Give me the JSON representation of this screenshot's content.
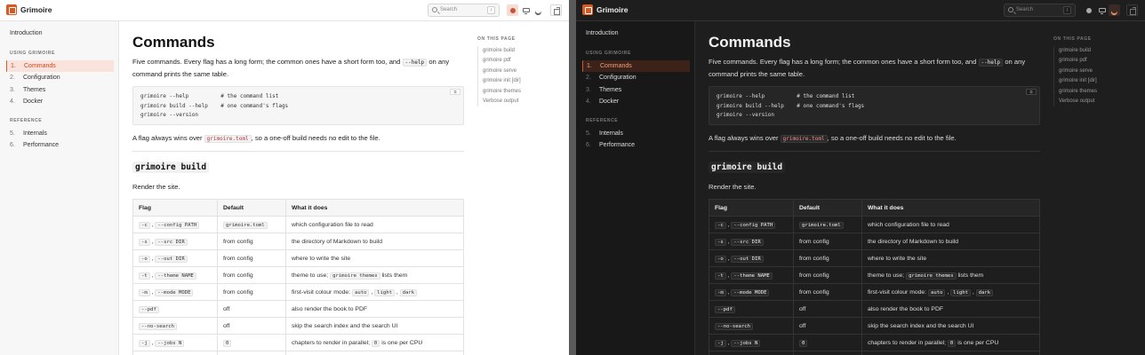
{
  "app": {
    "brand": "Grimoire",
    "search_placeholder": "Search",
    "search_shortcut": "/"
  },
  "sidebar": {
    "intro": "Introduction",
    "sections": [
      {
        "title": "USING GRIMOIRE",
        "items": [
          {
            "num": "1.",
            "label": "Commands",
            "active": true
          },
          {
            "num": "2.",
            "label": "Configuration"
          },
          {
            "num": "3.",
            "label": "Themes"
          },
          {
            "num": "4.",
            "label": "Docker"
          }
        ]
      },
      {
        "title": "REFERENCE",
        "items": [
          {
            "num": "5.",
            "label": "Internals"
          },
          {
            "num": "6.",
            "label": "Performance"
          }
        ]
      }
    ]
  },
  "main": {
    "title": "Commands",
    "intro_a": "Five commands. Every flag has a long form; the common ones have a short form too, and",
    "intro_code": "--help",
    "intro_b": "on any command prints the same table.",
    "code_lines": [
      "grimoire --help          # the command list",
      "grimoire build --help    # one command's flags",
      "grimoire --version"
    ],
    "copy_label": "⧉",
    "flag_a": "A flag always wins over",
    "flag_code": "grimoire.toml",
    "flag_b": ", so a one-off build needs no edit to the file.",
    "section_title": "grimoire build",
    "section_desc": "Render the site.",
    "table": {
      "headers": [
        "Flag",
        "Default",
        "What it does"
      ],
      "rows": [
        {
          "flag": [
            "-c",
            "--config PATH"
          ],
          "default": "grimoire.toml",
          "default_code": true,
          "desc": "which configuration file to read"
        },
        {
          "flag": [
            "-s",
            "--src DIR"
          ],
          "default": "from config",
          "desc": "the directory of Markdown to build"
        },
        {
          "flag": [
            "-o",
            "--out DIR"
          ],
          "default": "from config",
          "desc": "where to write the site"
        },
        {
          "flag": [
            "-t",
            "--theme NAME"
          ],
          "default": "from config",
          "desc_a": "theme to use;",
          "desc_code": "grimoire themes",
          "desc_b": "lists them"
        },
        {
          "flag": [
            "-m",
            "--mode MODE"
          ],
          "default": "from config",
          "desc_a": "first-visit colour mode:",
          "desc_codes": [
            "auto",
            "light",
            "dark"
          ]
        },
        {
          "flag": [
            "--pdf"
          ],
          "default": "off",
          "desc": "also render the book to PDF"
        },
        {
          "flag": [
            "--no-search"
          ],
          "default": "off",
          "desc": "skip the search index and the search UI"
        },
        {
          "flag": [
            "-j",
            "--jobs N"
          ],
          "default": "0",
          "default_code": true,
          "desc_a": "chapters to render in parallel;",
          "desc_code": "0",
          "desc_b": "is one per CPU"
        }
      ]
    }
  },
  "toc": {
    "title": "ON THIS PAGE",
    "items": [
      "grimoire build",
      "grimoire pdf",
      "grimoire serve",
      "grimoire init [dir]",
      "grimoire themes",
      "Verbose output"
    ]
  },
  "colors": {
    "accent": "#d9591e",
    "active_bg_light": "#fbe3dd",
    "active_bg_dark": "#3c2218"
  }
}
